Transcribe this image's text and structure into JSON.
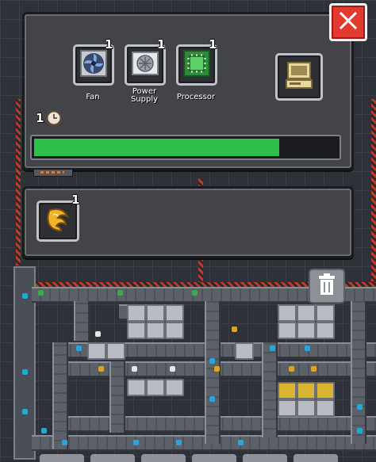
{
  "recipe": {
    "inputs": [
      {
        "name": "Fan",
        "count": "1",
        "icon": "fan-icon"
      },
      {
        "name": "Power Supply",
        "name_line1": "Power",
        "name_line2": "Supply",
        "count": "1",
        "icon": "power-supply-icon"
      },
      {
        "name": "Processor",
        "count": "1",
        "icon": "processor-icon"
      }
    ],
    "output_icon": "computer-icon",
    "time_value": "1",
    "time_icon": "clock-icon",
    "progress": 0.81
  },
  "inventory": {
    "slots": [
      {
        "count": "1",
        "icon": "gold-ore-icon"
      }
    ]
  },
  "controls": {
    "close_icon": "close-icon",
    "trash_icon": "trash-icon"
  },
  "colors": {
    "progress": "#2fbf4c",
    "close": "#e23a2e",
    "hazard": "#c0392b"
  }
}
